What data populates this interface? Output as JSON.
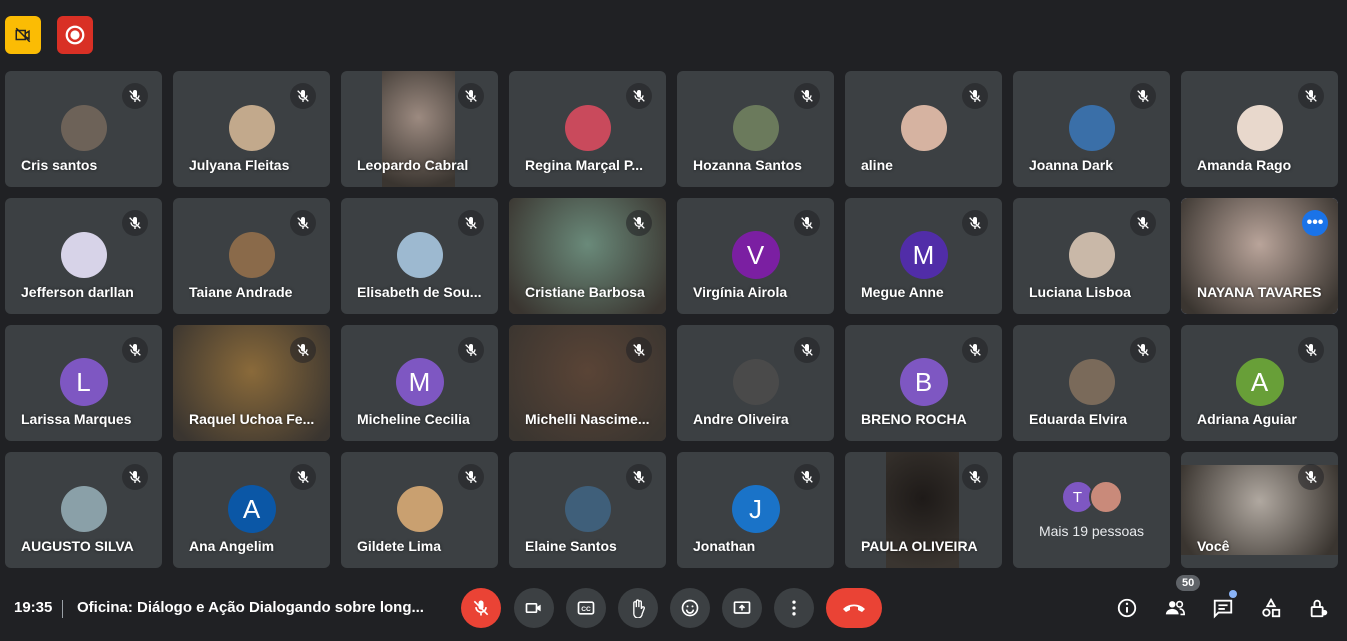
{
  "top": {
    "no_video_icon": "video-off-icon",
    "recording_icon": "record-icon"
  },
  "tiles": [
    {
      "name": "Cris santos",
      "avatar": "photo",
      "bg": "#6d6258"
    },
    {
      "name": "Julyana Fleitas",
      "avatar": "photo",
      "bg": "#c2a98c"
    },
    {
      "name": "Leopardo Cabral",
      "avatar": "video",
      "bg": "#9c8a80"
    },
    {
      "name": "Regina Marçal P...",
      "avatar": "photo",
      "bg": "#c94a5c"
    },
    {
      "name": "Hozanna Santos",
      "avatar": "photo",
      "bg": "#6b7a5c"
    },
    {
      "name": "aline",
      "avatar": "photo",
      "bg": "#d6b3a1"
    },
    {
      "name": "Joanna Dark",
      "avatar": "photo",
      "bg": "#3a6fa8"
    },
    {
      "name": "Amanda Rago",
      "avatar": "photo",
      "bg": "#e8d8cc"
    },
    {
      "name": "Jefferson darllan",
      "avatar": "photo",
      "bg": "#d7d3e8"
    },
    {
      "name": "Taiane Andrade",
      "avatar": "photo",
      "bg": "#8a6a4a"
    },
    {
      "name": "Elisabeth de Sou...",
      "avatar": "photo",
      "bg": "#9db9d0"
    },
    {
      "name": "Cristiane Barbosa",
      "avatar": "video",
      "bg": "#6a8a7a"
    },
    {
      "name": "Virgínia Airola",
      "avatar": "letter",
      "letter": "V",
      "bg": "#7b1fa2"
    },
    {
      "name": "Megue Anne",
      "avatar": "letter",
      "letter": "M",
      "bg": "#512da8"
    },
    {
      "name": "Luciana Lisboa",
      "avatar": "photo",
      "bg": "#c9b8a8"
    },
    {
      "name": "NAYANA TAVARES",
      "avatar": "video",
      "bg": "#b9a49a"
    },
    {
      "name": "Larissa Marques",
      "avatar": "letter",
      "letter": "L",
      "bg": "#7e57c2"
    },
    {
      "name": "Raquel Uchoa Fe...",
      "avatar": "video",
      "bg": "#8a6a3a"
    },
    {
      "name": "Micheline Cecilia",
      "avatar": "letter",
      "letter": "M",
      "bg": "#7e57c2"
    },
    {
      "name": "Michelli Nascime...",
      "avatar": "video",
      "bg": "#5a4436"
    },
    {
      "name": "Andre Oliveira",
      "avatar": "photo",
      "bg": "#4a4a4a"
    },
    {
      "name": "BRENO ROCHA",
      "avatar": "letter",
      "letter": "B",
      "bg": "#7e57c2"
    },
    {
      "name": "Eduarda Elvira",
      "avatar": "photo",
      "bg": "#7a6a5a"
    },
    {
      "name": "Adriana Aguiar",
      "avatar": "letter",
      "letter": "A",
      "bg": "#689f38"
    },
    {
      "name": "AUGUSTO SILVA",
      "avatar": "photo",
      "bg": "#8aa0a8"
    },
    {
      "name": "Ana Angelim",
      "avatar": "letter",
      "letter": "A",
      "bg": "#0b57a6"
    },
    {
      "name": "Gildete Lima",
      "avatar": "photo",
      "bg": "#c9a070"
    },
    {
      "name": "Elaine Santos",
      "avatar": "photo",
      "bg": "#3f5f7a"
    },
    {
      "name": "Jonathan",
      "avatar": "letter",
      "letter": "J",
      "bg": "#1a73c8"
    },
    {
      "name": "PAULA OLIVEIRA",
      "avatar": "video",
      "bg": "#1e1a18"
    },
    {
      "name": "",
      "avatar": "more",
      "bg": "#3c4043"
    },
    {
      "name": "Você",
      "avatar": "video",
      "bg": "#b0a8a0"
    }
  ],
  "more_tile": {
    "letter": "T",
    "label": "Mais 19 pessoas",
    "letter_bg": "#7e57c2"
  },
  "bottom": {
    "time": "19:35",
    "meeting_title": "Oficina: Diálogo e Ação Dialogando sobre long...",
    "participants_count": "50"
  },
  "controls": [
    {
      "name": "mic-off-icon",
      "red": true
    },
    {
      "name": "camera-icon"
    },
    {
      "name": "captions-icon"
    },
    {
      "name": "raise-hand-icon"
    },
    {
      "name": "emoji-icon"
    },
    {
      "name": "present-screen-icon"
    },
    {
      "name": "more-options-icon"
    },
    {
      "name": "leave-call-icon",
      "leave": true
    }
  ],
  "right_icons": [
    "info-icon",
    "people-icon",
    "chat-icon",
    "activities-icon",
    "host-controls-icon"
  ],
  "colors": {
    "background": "#202124",
    "tile": "#3c4043",
    "accent": "#8ab4f8",
    "danger": "#ea4335"
  }
}
